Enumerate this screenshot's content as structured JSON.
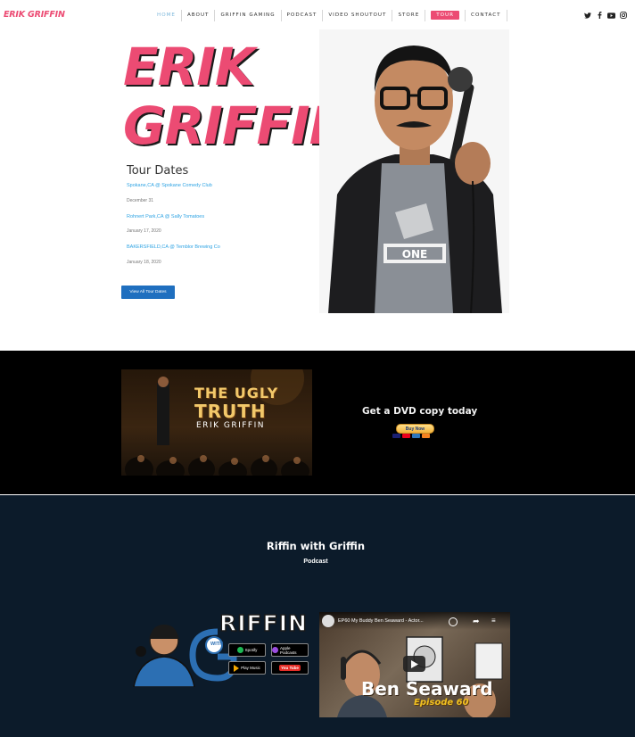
{
  "header": {
    "logo": "ERIK GRIFFIN",
    "nav": [
      {
        "label": "HOME",
        "key": "home"
      },
      {
        "label": "ABOUT",
        "key": "about"
      },
      {
        "label": "GRIFFIN GAMING",
        "key": "gaming"
      },
      {
        "label": "PODCAST",
        "key": "podcast"
      },
      {
        "label": "VIDEO SHOUTOUT",
        "key": "shoutout"
      },
      {
        "label": "STORE",
        "key": "store"
      },
      {
        "label": "TOUR",
        "key": "tour"
      },
      {
        "label": "CONTACT",
        "key": "contact"
      }
    ],
    "social_icons": [
      "twitter-icon",
      "facebook-icon",
      "youtube-icon",
      "instagram-icon"
    ]
  },
  "hero": {
    "title_line1": "ERIK",
    "title_line2": "GRIFFIN",
    "tour_heading": "Tour Dates",
    "events": [
      {
        "venue": "Spokane,CA @ Spokane Comedy Club",
        "date": "December 31"
      },
      {
        "venue": "Rohnert Park,CA @ Sally Tomatoes",
        "date": "January 17, 2020"
      },
      {
        "venue": "BAKERSFIELD,CA @ Temblor Brewing Co",
        "date": "January 18, 2020"
      }
    ],
    "view_all_label": "View All Tour Dates"
  },
  "dvd": {
    "title_line1": "THE UGLY",
    "title_line2": "TRUTH",
    "artist": "ERIK GRIFFIN",
    "cta": "Get a DVD copy today",
    "buy_label": "Buy Now"
  },
  "podcast": {
    "title": "Riffin with Griffin",
    "subtitle": "Podcast",
    "logo_text": "RIFFIN",
    "logo_g": "G",
    "logo_with": "WITH",
    "badges": [
      {
        "top": "Listen on",
        "main": "Spotify",
        "color": "#1db954"
      },
      {
        "top": "Listen on",
        "main": "Apple Podcasts",
        "color": "#9b4de0"
      },
      {
        "top": "Listen on Google",
        "main": "Play Music",
        "color": "#f4a800"
      },
      {
        "top": "",
        "main": "You Tube",
        "color": "#e52d27"
      }
    ],
    "video_title": "EP60 My Buddy Ben Seaward - Actor...",
    "video_actions": [
      "Watch later",
      "Share",
      "Info"
    ],
    "episode_name": "Ben Seaward",
    "episode_number": "Episode 60"
  },
  "colors": {
    "accent_pink": "#ec4b73",
    "link_blue": "#2ea3e3",
    "button_blue": "#1f6fbf",
    "podcast_bg": "#0c1b2a"
  }
}
